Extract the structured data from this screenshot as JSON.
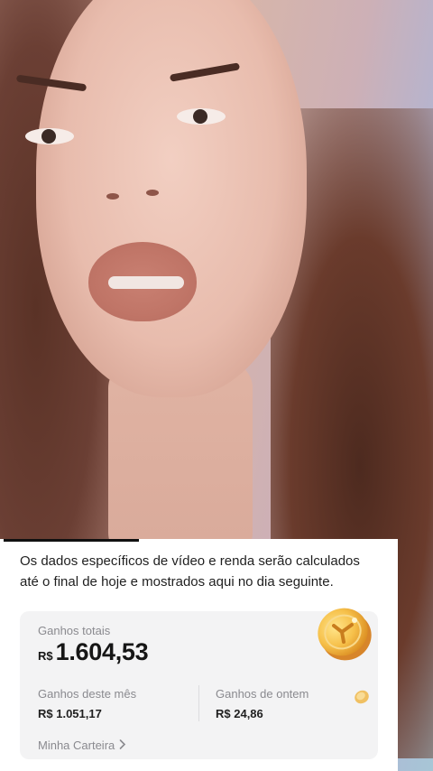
{
  "notice": {
    "line1": "Os dados específicos de vídeo e renda serão calculados",
    "line2": "até o final de hoje e mostrados aqui no dia seguinte."
  },
  "earnings": {
    "total_label": "Ganhos totais",
    "currency": "R$",
    "total_value": "1.604,53",
    "month_label": "Ganhos deste mês",
    "month_value": "R$ 1.051,17",
    "yesterday_label": "Ganhos de ontem",
    "yesterday_value": "R$ 24,86",
    "wallet_link": "Minha Carteira"
  },
  "icons": {
    "coin": "gold-coin-icon",
    "chevron": "chevron-right-icon"
  },
  "colors": {
    "panel_bg": "#ffffff",
    "card_bg": "#f3f3f4",
    "label_gray": "#8a8a8f",
    "coin_gold": "#f2b53a"
  }
}
